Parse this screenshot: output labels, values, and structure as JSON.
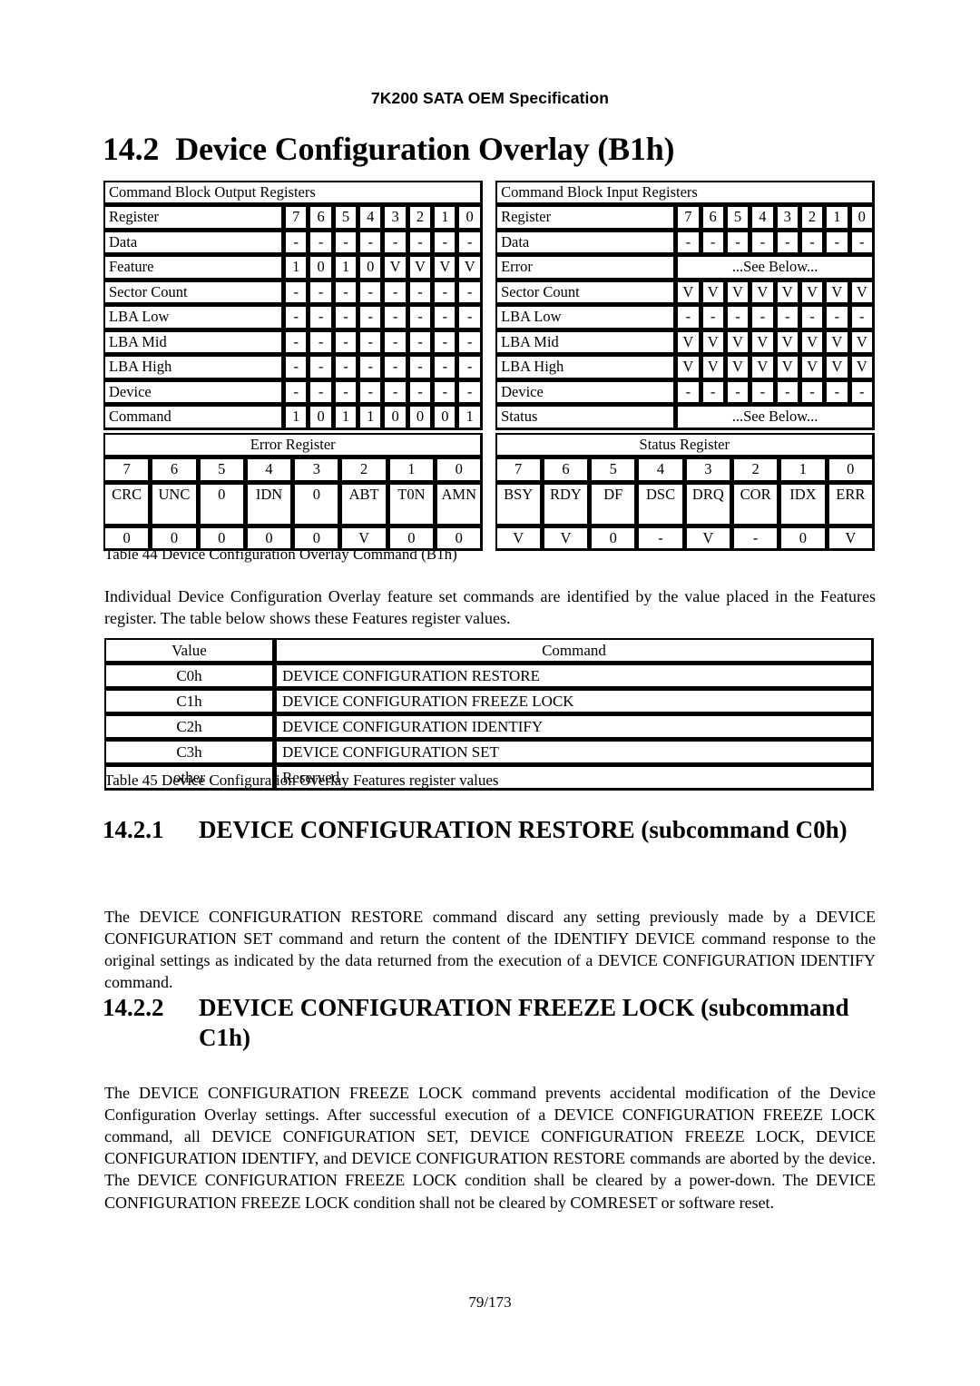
{
  "header": {
    "running_title": "7K200 SATA OEM Specification"
  },
  "title": {
    "number": "14.2",
    "text": "Device Configuration Overlay (B1h)"
  },
  "command_block": {
    "output": {
      "caption": "Command Block Output Registers",
      "bit_header_label": "Register",
      "bits": [
        "7",
        "6",
        "5",
        "4",
        "3",
        "2",
        "1",
        "0"
      ],
      "rows": [
        {
          "name": "Data",
          "values": [
            "-",
            "-",
            "-",
            "-",
            "-",
            "-",
            "-",
            "-"
          ]
        },
        {
          "name": "Feature",
          "values": [
            "1",
            "0",
            "1",
            "0",
            "V",
            "V",
            "V",
            "V"
          ]
        },
        {
          "name": "Sector Count",
          "values": [
            "-",
            "-",
            "-",
            "-",
            "-",
            "-",
            "-",
            "-"
          ]
        },
        {
          "name": "LBA Low",
          "values": [
            "-",
            "-",
            "-",
            "-",
            "-",
            "-",
            "-",
            "-"
          ]
        },
        {
          "name": "LBA Mid",
          "values": [
            "-",
            "-",
            "-",
            "-",
            "-",
            "-",
            "-",
            "-"
          ]
        },
        {
          "name": "LBA High",
          "values": [
            "-",
            "-",
            "-",
            "-",
            "-",
            "-",
            "-",
            "-"
          ]
        },
        {
          "name": "Device",
          "values": [
            "-",
            "-",
            "-",
            "-",
            "-",
            "-",
            "-",
            "-"
          ]
        },
        {
          "name": "Command",
          "values": [
            "1",
            "0",
            "1",
            "1",
            "0",
            "0",
            "0",
            "1"
          ]
        }
      ]
    },
    "input": {
      "caption": "Command Block Input Registers",
      "bit_header_label": "Register",
      "bits": [
        "7",
        "6",
        "5",
        "4",
        "3",
        "2",
        "1",
        "0"
      ],
      "see_below": "...See Below...",
      "rows": [
        {
          "name": "Data",
          "values": [
            "-",
            "-",
            "-",
            "-",
            "-",
            "-",
            "-",
            "-"
          ],
          "span": false
        },
        {
          "name": "Error",
          "span_text": "...See Below...",
          "span": true
        },
        {
          "name": "Sector Count",
          "values": [
            "V",
            "V",
            "V",
            "V",
            "V",
            "V",
            "V",
            "V"
          ],
          "span": false
        },
        {
          "name": "LBA Low",
          "values": [
            "-",
            "-",
            "-",
            "-",
            "-",
            "-",
            "-",
            "-"
          ],
          "span": false
        },
        {
          "name": "LBA Mid",
          "values": [
            "V",
            "V",
            "V",
            "V",
            "V",
            "V",
            "V",
            "V"
          ],
          "span": false
        },
        {
          "name": "LBA High",
          "values": [
            "V",
            "V",
            "V",
            "V",
            "V",
            "V",
            "V",
            "V"
          ],
          "span": false
        },
        {
          "name": "Device",
          "values": [
            "-",
            "-",
            "-",
            "-",
            "-",
            "-",
            "-",
            "-"
          ],
          "span": false
        },
        {
          "name": "Status",
          "span_text": "...See Below...",
          "span": true
        }
      ]
    }
  },
  "error_register": {
    "title": "Error Register",
    "bits": [
      "7",
      "6",
      "5",
      "4",
      "3",
      "2",
      "1",
      "0"
    ],
    "mnemonics": [
      "CRC",
      "UNC",
      "0",
      "IDN",
      "0",
      "ABT",
      "T0N",
      "AMN"
    ],
    "values": [
      "0",
      "0",
      "0",
      "0",
      "0",
      "V",
      "0",
      "0"
    ]
  },
  "status_register": {
    "title": "Status Register",
    "bits": [
      "7",
      "6",
      "5",
      "4",
      "3",
      "2",
      "1",
      "0"
    ],
    "mnemonics": [
      "BSY",
      "RDY",
      "DF",
      "DSC",
      "DRQ",
      "COR",
      "IDX",
      "ERR"
    ],
    "values": [
      "V",
      "V",
      "0",
      "-",
      "V",
      "-",
      "0",
      "V"
    ]
  },
  "captions": {
    "table44": "Table 44 Device Configuration Overlay Command (B1h)",
    "table45": "Table 45 Device Configuration Overlay Features register values"
  },
  "paragraphs": {
    "intro": "Individual Device Configuration Overlay feature set commands are identified by the value placed in the Features register. The table below shows these Features register values.",
    "restore": "The DEVICE CONFIGURATION RESTORE command discard any setting previously made by a DEVICE CONFIGURATION SET command and return the content of the IDENTIFY DEVICE command response to the original settings as indicated by the data returned from the execution of a DEVICE CONFIGURATION IDENTIFY command.",
    "freeze_lock": "The DEVICE CONFIGURATION FREEZE LOCK command prevents accidental modification of the Device Configuration Overlay settings. After successful execution of a DEVICE CONFIGURATION FREEZE LOCK command, all DEVICE CONFIGURATION SET, DEVICE CONFIGURATION FREEZE LOCK, DEVICE CONFIGURATION IDENTIFY, and DEVICE CONFIGURATION RESTORE commands are aborted by the device. The DEVICE CONFIGURATION FREEZE LOCK condition shall be cleared by a power-down. The DEVICE CONFIGURATION FREEZE LOCK condition shall not be cleared by COMRESET or software reset."
  },
  "features_table": {
    "headers": [
      "Value",
      "Command"
    ],
    "rows": [
      {
        "value": "C0h",
        "command": "DEVICE CONFIGURATION RESTORE"
      },
      {
        "value": "C1h",
        "command": "DEVICE CONFIGURATION FREEZE LOCK"
      },
      {
        "value": "C2h",
        "command": "DEVICE CONFIGURATION IDENTIFY"
      },
      {
        "value": "C3h",
        "command": "DEVICE CONFIGURATION SET"
      },
      {
        "value": "other",
        "command": "Reserved"
      }
    ]
  },
  "subsections": [
    {
      "number": "14.2.1",
      "title": "DEVICE CONFIGURATION RESTORE (subcommand C0h)"
    },
    {
      "number": "14.2.2",
      "title": "DEVICE CONFIGURATION FREEZE LOCK (subcommand C1h)"
    }
  ],
  "footer": {
    "page_number": "79/173"
  }
}
